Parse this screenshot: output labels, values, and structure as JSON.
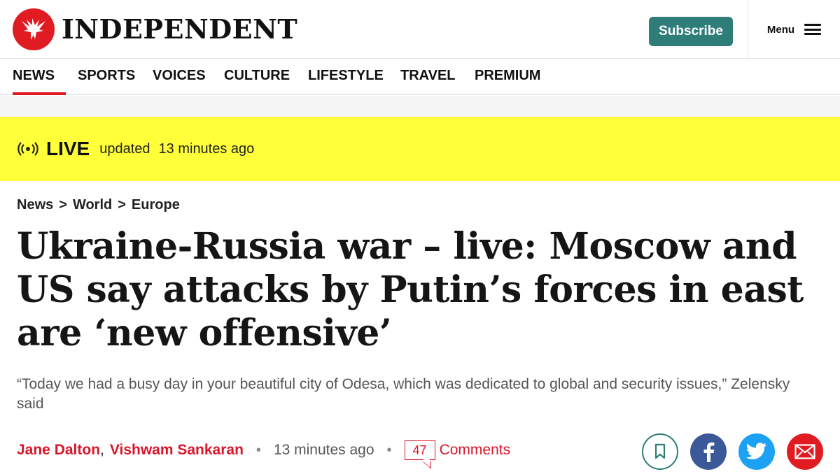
{
  "header": {
    "brand": "INDEPENDENT",
    "subscribe_label": "Subscribe",
    "menu_label": "Menu"
  },
  "nav": {
    "items": [
      {
        "label": "NEWS",
        "active": true
      },
      {
        "label": "SPORTS"
      },
      {
        "label": "VOICES"
      },
      {
        "label": "CULTURE"
      },
      {
        "label": "LIFESTYLE"
      },
      {
        "label": "TRAVEL"
      },
      {
        "label": "PREMIUM"
      }
    ]
  },
  "live": {
    "label": "LIVE",
    "updated_label": "updated",
    "time": "13 minutes ago"
  },
  "breadcrumb": [
    "News",
    ">",
    "World",
    ">",
    "Europe"
  ],
  "article": {
    "headline": "Ukraine-Russia war – live: Moscow and US say attacks by Putin’s forces in east are ‘new offensive’",
    "standfirst": "“Today we had a busy day in your beautiful city of Odesa, which was dedicated to global and security issues,” Zelensky said",
    "authors": [
      "Jane Dalton",
      "Vishwam Sankaran"
    ],
    "author_separator": ",",
    "bullet": "•",
    "time": "13 minutes ago",
    "comment_count": "47",
    "comments_label": "Comments"
  },
  "colors": {
    "brand_red": "#e11b22",
    "subscribe_teal": "#2f7d79",
    "live_yellow": "#ffff3a",
    "facebook": "#3b5998",
    "twitter": "#1da1f2"
  },
  "icons": {
    "logo": "eagle-icon",
    "menu": "hamburger-icon",
    "live": "broadcast-icon",
    "bookmark": "bookmark-icon",
    "facebook": "facebook-icon",
    "twitter": "twitter-icon",
    "email": "email-icon"
  }
}
